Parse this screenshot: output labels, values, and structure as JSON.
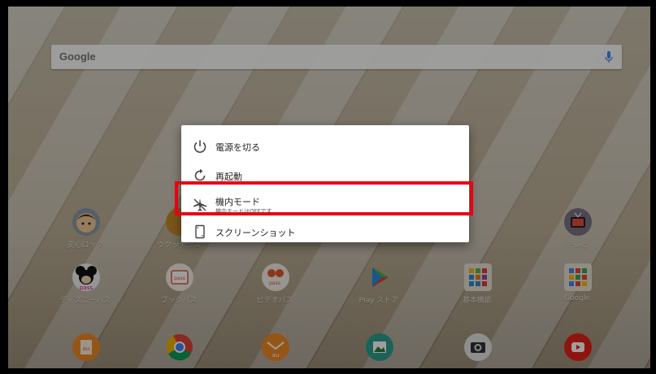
{
  "search": {
    "logo": "Google",
    "icon": "mic-icon"
  },
  "power_menu": {
    "items": [
      {
        "label": "電源を切る",
        "icon": "power-icon"
      },
      {
        "label": "再起動",
        "icon": "restart-icon"
      },
      {
        "label": "機内モード",
        "sublabel": "機内モードはOFFです",
        "icon": "airplane-icon"
      },
      {
        "label": "スクリーンショット",
        "icon": "screenshot-icon"
      }
    ],
    "highlight_color": "#e80013"
  },
  "apps_row1": [
    {
      "label": "安心ロック",
      "icon": "kid-face-icon"
    },
    {
      "label": "ウクッテラス",
      "icon": "app-icon"
    },
    {
      "label": ""
    },
    {
      "label": ""
    },
    {
      "label": ""
    },
    {
      "label": "テレビ",
      "icon": "tv-icon"
    }
  ],
  "apps_row2": [
    {
      "label": "ディズニーパス",
      "icon": "mickey-icon"
    },
    {
      "label": "ブックパス",
      "icon": "bookpass-icon"
    },
    {
      "label": "ビデオパス",
      "icon": "videopass-icon"
    },
    {
      "label": "Play ストア",
      "icon": "play-store-icon"
    },
    {
      "label": "基本機能",
      "icon": "folder-icon"
    },
    {
      "label": "Google",
      "icon": "google-folder-icon"
    }
  ],
  "apps_row3": [
    {
      "icon": "au-icon"
    },
    {
      "icon": "chrome-icon"
    },
    {
      "icon": "au-mail-icon"
    },
    {
      "icon": "gallery-icon"
    },
    {
      "icon": "camera-icon"
    },
    {
      "icon": "youtube-icon"
    }
  ],
  "colors": {
    "accent": "#e80013",
    "dialog_bg": "#ffffff"
  }
}
